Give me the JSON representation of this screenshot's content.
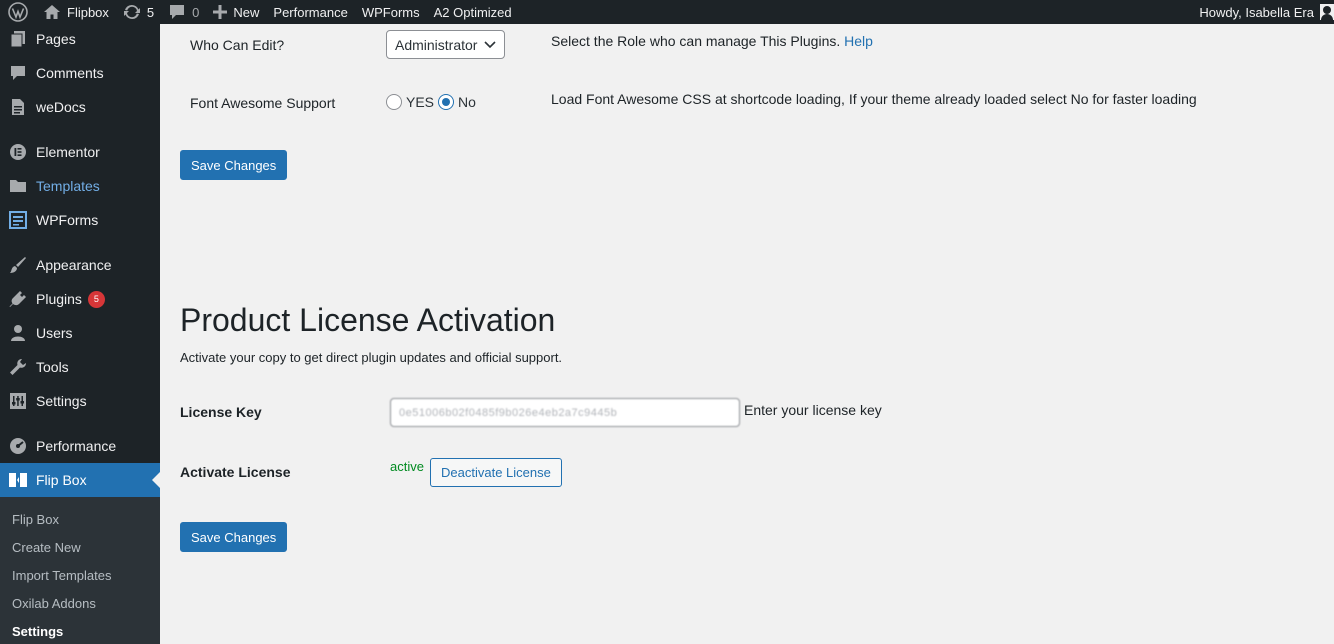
{
  "adminbar": {
    "site_name": "Flipbox",
    "updates_count": "5",
    "comments_count": "0",
    "new_label": "New",
    "performance_label": "Performance",
    "wpforms_label": "WPForms",
    "a2_label": "A2 Optimized",
    "howdy": "Howdy, Isabella Era"
  },
  "sidebar": {
    "pages": "Pages",
    "comments": "Comments",
    "wedocs": "weDocs",
    "elementor": "Elementor",
    "templates": "Templates",
    "wpforms": "WPForms",
    "appearance": "Appearance",
    "plugins": "Plugins",
    "plugins_badge": "5",
    "users": "Users",
    "tools": "Tools",
    "settings": "Settings",
    "performance": "Performance",
    "flipbox": "Flip Box",
    "submenu": {
      "flip_box": "Flip Box",
      "create_new": "Create New",
      "import_templates": "Import Templates",
      "oxilab_addons": "Oxilab Addons",
      "settings": "Settings"
    }
  },
  "settings": {
    "who_can_edit_label": "Who Can Edit?",
    "who_can_edit_value": "Administrator",
    "who_can_edit_desc": "Select the Role who can manage This Plugins.",
    "help_link": "Help",
    "font_awesome_label": "Font Awesome Support",
    "yes_label": "YES",
    "no_label": "No",
    "font_awesome_desc": "Load Font Awesome CSS at shortcode loading, If your theme already loaded select No for faster loading",
    "save_label": "Save Changes"
  },
  "license": {
    "title": "Product License Activation",
    "subtitle": "Activate your copy to get direct plugin updates and official support.",
    "key_label": "License Key",
    "key_value": "0e51006b02f0485f9b026e4eb2a7c9445b",
    "key_desc": "Enter your license key",
    "activate_label": "Activate License",
    "status": "active",
    "deactivate_label": "Deactivate License",
    "save_label": "Save Changes"
  }
}
